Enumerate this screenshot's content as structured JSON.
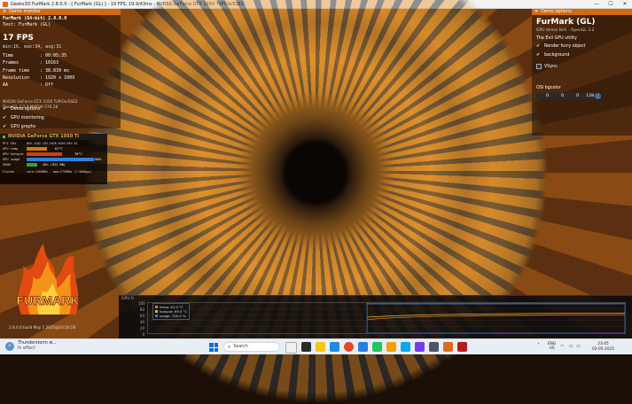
{
  "window": {
    "title": "Geeks3D FurMark 2.8.0.0 - [ FurMark (GL) ] - 19 FPS, 19.9/43ms - NVIDIA GeForce GTX 1050 Ti/PCIe/SSE2",
    "min": "—",
    "max": "☐",
    "close": "✕"
  },
  "left_panel": {
    "header": "Demo monitor",
    "app_name": "FurMark (64-bit) 2.8.0.0",
    "test": "Test: FurMark (GL)",
    "fps": "17 FPS",
    "minmax": "min:16, max:34, avg:31",
    "stats": [
      {
        "k": "Time",
        "v": ": 00:05:35"
      },
      {
        "k": "Frames",
        "v": ": 10163"
      },
      {
        "k": "Frame time",
        "v": ": 38.839 ms"
      },
      {
        "k": "Resolution",
        "v": ": 1920 x 1009"
      },
      {
        "k": "AA",
        "v": ": Off"
      }
    ],
    "gpu_line1": "NVIDIA GeForce GTX 1050 Ti/PCIe/SSE2",
    "gpu_line2": "OpenGL 3.2.0 NVIDIA 576.28",
    "options": [
      "Demo options",
      "GPU monitoring",
      "GPU graphs"
    ]
  },
  "gpu_monitor": {
    "header": "NVIDIA GeForce GTX 1050 Ti",
    "rows": [
      {
        "label": "PCI IDs",
        "value": "DEV-1C82-1D3-1026-6453-REV-A1"
      },
      {
        "label": "GPU temp",
        "value": "61°C"
      },
      {
        "label": "GPU hotspot",
        "value": "70°C"
      },
      {
        "label": "GPU usage",
        "value": "100%"
      },
      {
        "label": "VRAM",
        "value": "20% (922 MB)"
      },
      {
        "label": "Clocks",
        "value": "core:1493MHz - mem:1753MHz (7.00Gbps)"
      }
    ],
    "temp_fraction": 0.61,
    "hotspot_fraction": 0.7,
    "usage_fraction": 1.0,
    "vram_fraction": 0.2
  },
  "right_panel": {
    "header": "Demo options",
    "title": "FurMark (GL)",
    "subtitle": "GPU stress test - OpenGL 3.2",
    "utility": "The Evil GPU utility",
    "opt1": "Render furry object",
    "opt2": "background",
    "vsync": "VSync",
    "osi_label": "OSI bgcolor",
    "osi_values": [
      "0",
      "0",
      "0",
      "128"
    ]
  },
  "logo": {
    "text": "FURMARK",
    "version": "2.8.0.0 build May 1 2025@16:50:28"
  },
  "graph": {
    "label": "GPU 0",
    "yticks": [
      "100",
      "80",
      "60",
      "40",
      "20",
      "0"
    ],
    "legend": [
      {
        "text": "temp: 61.0 °C",
        "color": "#e07a1e"
      },
      {
        "text": "hotspot: 69.5 °C",
        "color": "#e8b04a"
      },
      {
        "text": "usage: 100.0 %",
        "color": "#2e7fd1"
      }
    ]
  },
  "taskbar": {
    "weather_title": "Thunderstorm w...",
    "weather_sub": "In effect",
    "search_placeholder": "Search",
    "lang1": "ENG",
    "lang2": "US",
    "time": "23:45",
    "date": "02-05-2025"
  }
}
